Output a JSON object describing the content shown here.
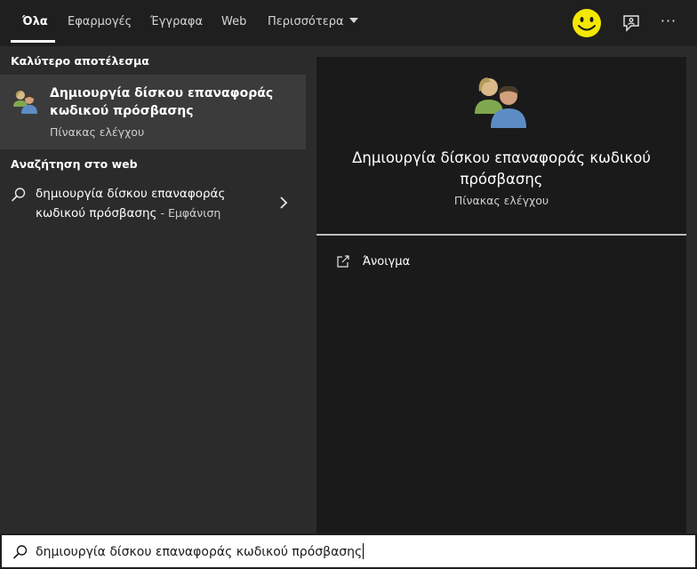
{
  "tabs": [
    {
      "label": "Όλα",
      "active": true
    },
    {
      "label": "Εφαρμογές"
    },
    {
      "label": "Έγγραφα"
    },
    {
      "label": "Web"
    },
    {
      "label": "Περισσότερα"
    }
  ],
  "header_icons": [
    "smiley-icon",
    "feedback-icon",
    "more-options-icon"
  ],
  "left": {
    "best_match_heading": "Καλύτερο αποτέλεσμα",
    "best_match": {
      "title": "Δημιουργία δίσκου επαναφοράς κωδικού πρόσβασης",
      "subtitle": "Πίνακας ελέγχου",
      "icon": "users-icon"
    },
    "web_heading": "Αναζήτηση στο web",
    "web_result": {
      "query": "δημιουργία δίσκου επαναφοράς κωδικού πρόσβασης",
      "suffix": " - Εμφάνιση",
      "icon": "search-icon"
    }
  },
  "preview": {
    "title": "Δημιουργία δίσκου επαναφοράς κωδικού πρόσβασης",
    "subtitle": "Πίνακας ελέγχου",
    "actions": [
      {
        "label": "Άνοιγμα",
        "icon": "open-icon"
      }
    ]
  },
  "search": {
    "value": "δημιουργία δίσκου επαναφοράς κωδικού πρόσβασης"
  },
  "colors": {
    "background": "#1e1e1e",
    "panel": "#2b2b2b",
    "selected": "#3b3b3b",
    "preview_bg": "#1a1a1a",
    "smiley": "#f4e800"
  }
}
